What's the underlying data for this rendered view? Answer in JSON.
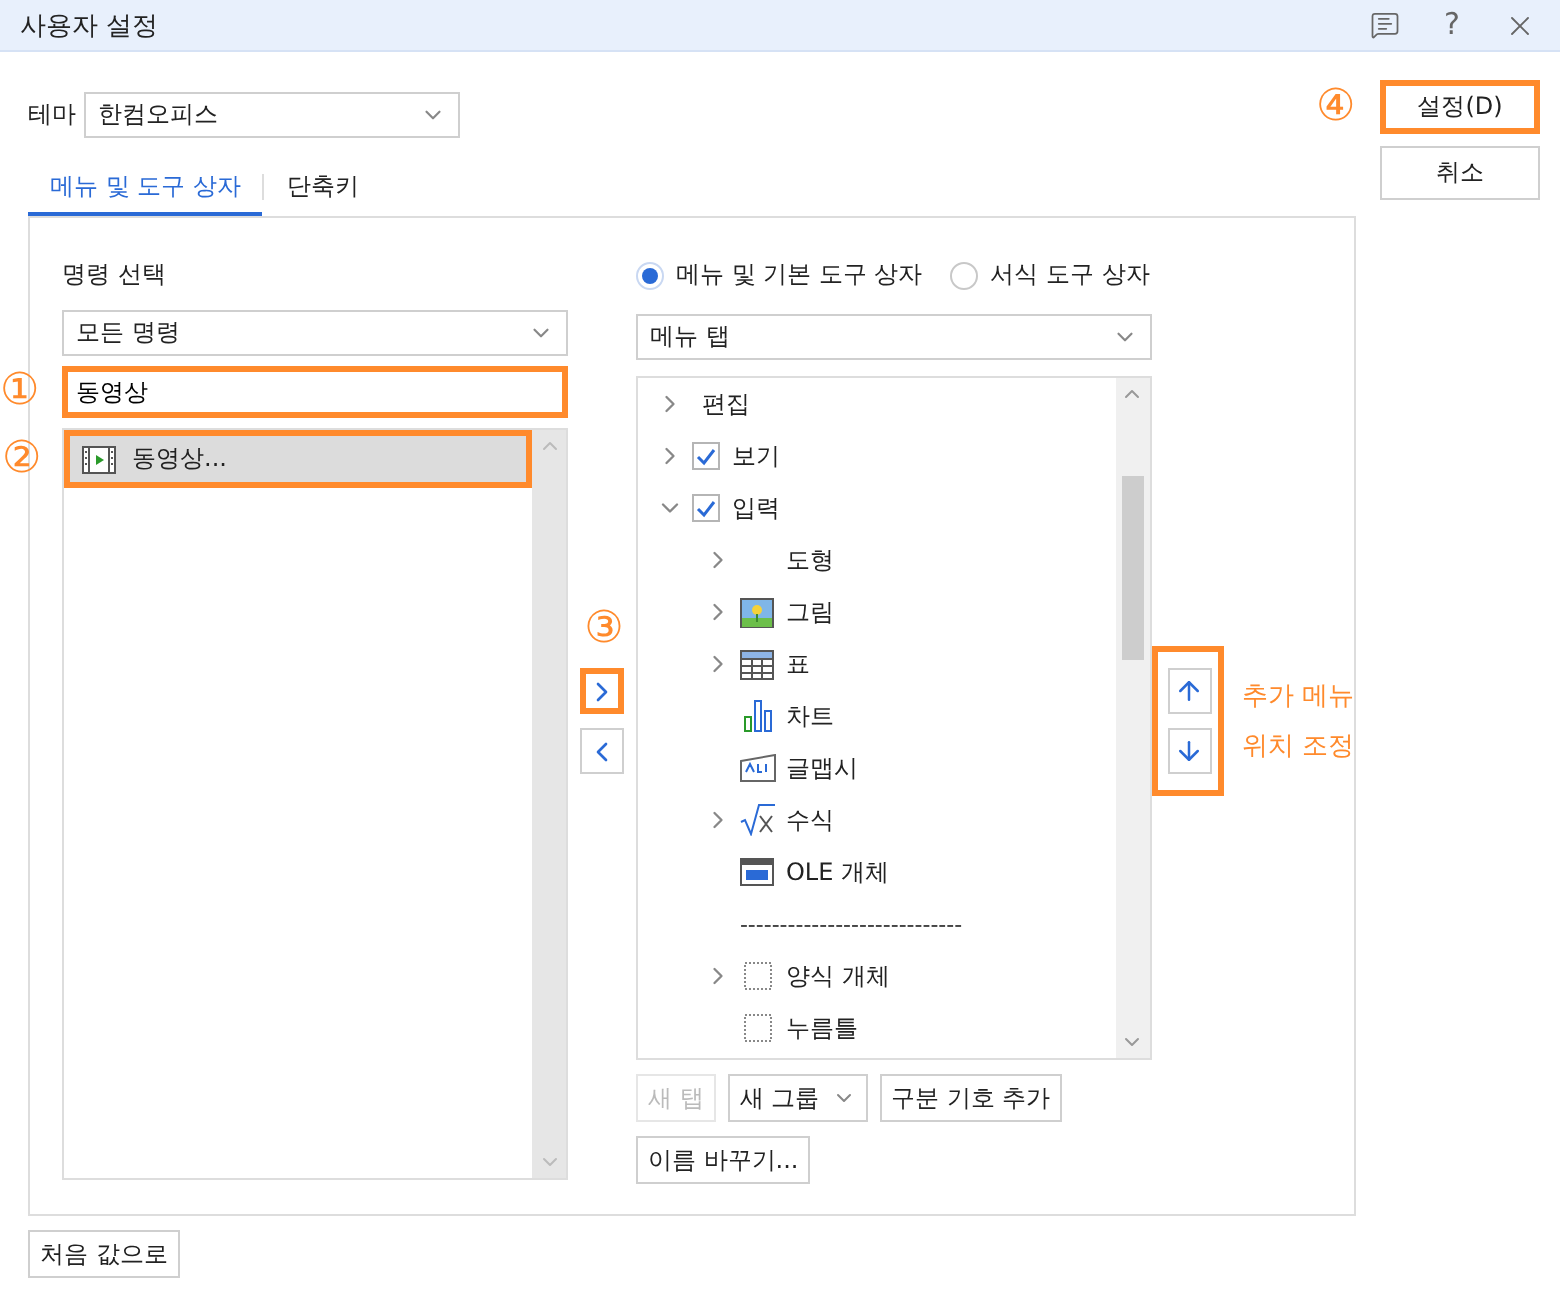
{
  "window": {
    "title": "사용자 설정",
    "help_glyph": "?"
  },
  "theme": {
    "label": "테마",
    "value": "한컴오피스"
  },
  "dialog_buttons": [
    {
      "label": "설정(D)",
      "highlight": true,
      "callout": "④"
    },
    {
      "label": "취소",
      "highlight": false
    }
  ],
  "tabs": [
    {
      "label": "메뉴 및 도구 상자",
      "selected": true
    },
    {
      "label": "단축키",
      "selected": false
    }
  ],
  "command_panel": {
    "label": "명령 선택",
    "category": "모든 명령",
    "search": {
      "value": "동영상",
      "highlight": true,
      "callout": "①"
    },
    "results": [
      {
        "label": "동영상...",
        "selected": true,
        "highlight": true,
        "callout": "②"
      }
    ]
  },
  "transfer": {
    "callout": "③",
    "buttons": [
      {
        "kind": "add",
        "highlight": true
      },
      {
        "kind": "remove",
        "highlight": false
      }
    ]
  },
  "menu_panel": {
    "radios": [
      {
        "label": "메뉴 및 기본 도구 상자",
        "selected": true
      },
      {
        "label": "서식 도구 상자",
        "selected": false
      }
    ],
    "target": "메뉴 탭",
    "tree": [
      {
        "label": "편집",
        "expanded": false
      },
      {
        "label": "보기",
        "expanded": false,
        "checked": true
      },
      {
        "label": "입력",
        "expanded": true,
        "checked": true,
        "children": [
          {
            "label": "도형",
            "kind": "blank",
            "expanded": false
          },
          {
            "label": "그림",
            "kind": "picture",
            "expanded": false
          },
          {
            "label": "표",
            "kind": "table",
            "expanded": false
          },
          {
            "label": "차트",
            "kind": "chart"
          },
          {
            "label": "글맵시",
            "kind": "textart"
          },
          {
            "label": "수식",
            "kind": "equation",
            "expanded": false
          },
          {
            "label": "OLE 개체",
            "kind": "ole"
          },
          {
            "label": "----------------------------",
            "kind": "separator"
          },
          {
            "label": "양식 개체",
            "kind": "dotted",
            "expanded": false
          },
          {
            "label": "누름틀",
            "kind": "dotted"
          }
        ]
      }
    ],
    "buttons": [
      {
        "label": "새 탭",
        "kind": "plain",
        "disabled": true
      },
      {
        "label": "새 그룹",
        "kind": "dropdown",
        "disabled": false
      },
      {
        "label": "구분 기호 추가",
        "kind": "plain",
        "disabled": false
      },
      {
        "label": "이름 바꾸기...",
        "kind": "plain",
        "disabled": false
      }
    ]
  },
  "reorder": {
    "highlight": true,
    "note": [
      "추가 메뉴",
      "위치 조정"
    ],
    "buttons": [
      {
        "kind": "up"
      },
      {
        "kind": "down"
      }
    ]
  },
  "footer": {
    "reset_button": "처음 값으로"
  }
}
